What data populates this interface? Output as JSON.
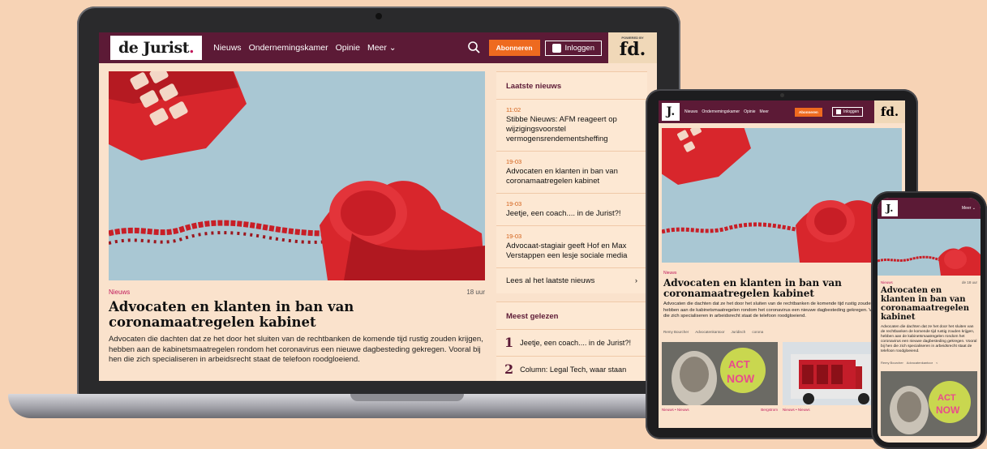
{
  "site": {
    "logo_text": "de Jurist",
    "logo_dot": ".",
    "nav_items": [
      "Nieuws",
      "Ondernemingskamer",
      "Opinie",
      "Meer ⌄"
    ],
    "subscribe_label": "Abonneren",
    "login_label": "Inloggen",
    "partner_logo": "fd.",
    "partner_small": "POWERED BY"
  },
  "article": {
    "tag": "Nieuws",
    "time": "18 uur",
    "headline": "Advocaten en klanten in ban van coronamaatregelen kabinet",
    "lead": "Advocaten die dachten dat ze het door het sluiten van de rechtbanken de komende tijd rustig zouden krijgen, hebben aan de kabinetsmaatregelen rondom het coronavirus een nieuwe dagbesteding gekregen. Vooral bij hen die zich specialiseren in arbeidsrecht staat de telefoon roodgloeiend."
  },
  "latest": {
    "title": "Laatste nieuws",
    "items": [
      {
        "time": "11:02",
        "title": "Stibbe Nieuws: AFM reageert op wijzigingsvoorstel vermogensrendementsheffing"
      },
      {
        "time": "19-03",
        "title": "Advocaten en klanten in ban van coronamaatregelen kabinet"
      },
      {
        "time": "19-03",
        "title": "Jeetje, een coach.... in de Jurist?!"
      },
      {
        "time": "19-03",
        "title": "Advocaat-stagiair geeft Hof en Max Verstappen een lesje sociale media"
      }
    ],
    "more_label": "Lees al het laatste nieuws",
    "more_arrow": "›"
  },
  "most_read": {
    "title": "Meest gelezen",
    "items": [
      {
        "num": "1",
        "title": "Jeetje, een coach.... in de Jurist?!"
      },
      {
        "num": "2",
        "title": "Column: Legal Tech, waar staan"
      }
    ]
  },
  "tablet": {
    "logo": "J.",
    "nav_items": [
      "Nieuws",
      "Ondernemingskamer",
      "Opinie",
      "Meer"
    ],
    "subscribe_label": "Abonneren",
    "login_label": "Inloggen",
    "partner_logo": "fd.",
    "tag": "Nieuws",
    "headline": "Advocaten en klanten in ban van coronamaatregelen kabinet",
    "lead": "Advocaten die dachten dat ze het door het sluiten van de rechtbanken de komende tijd rustig zouden krijgen, hebben aan de kabinetsmaatregelen rondom het coronavirus een nieuwe dagbesteding gekregen. Vooral bij hen die zich specialiseren in arbeidsrecht staat de telefoon roodgloeiend.",
    "meta_tags": [
      "Remy Bourcher",
      "Advocatenkantoor",
      "Juridisch",
      "corona"
    ],
    "share_label": "Delen",
    "card1_meta": "Nieuws • Nieuws",
    "card1_meta_right": "Bergstrom",
    "card2_meta": "Nieuws • Nieuws"
  },
  "phone": {
    "logo": "J.",
    "menu_label": "Meer ⌄",
    "tag": "Nieuws",
    "time": "de 18 uur",
    "headline": "Advocaten en klanten in ban van coronamaatregelen kabinet",
    "lead": "Advocaten die dachten dat ze het door het sluiten van de rechtbanken de komende tijd rustig zouden krijgen, hebben aan de kabinetsmaatregelen rondom het coronavirus een nieuwe dagbesteding gekregen. Vooral bij hen die zich specialiseren in arbeidsrecht staat de telefoon roodgloeiend.",
    "meta_tags": [
      "Remy Bourcher",
      "Advocatenkantoor"
    ]
  },
  "colors": {
    "brand": "#5c1a36",
    "accent": "#ee6a1f",
    "background": "#f7d3b5",
    "page": "#fae2cc"
  }
}
